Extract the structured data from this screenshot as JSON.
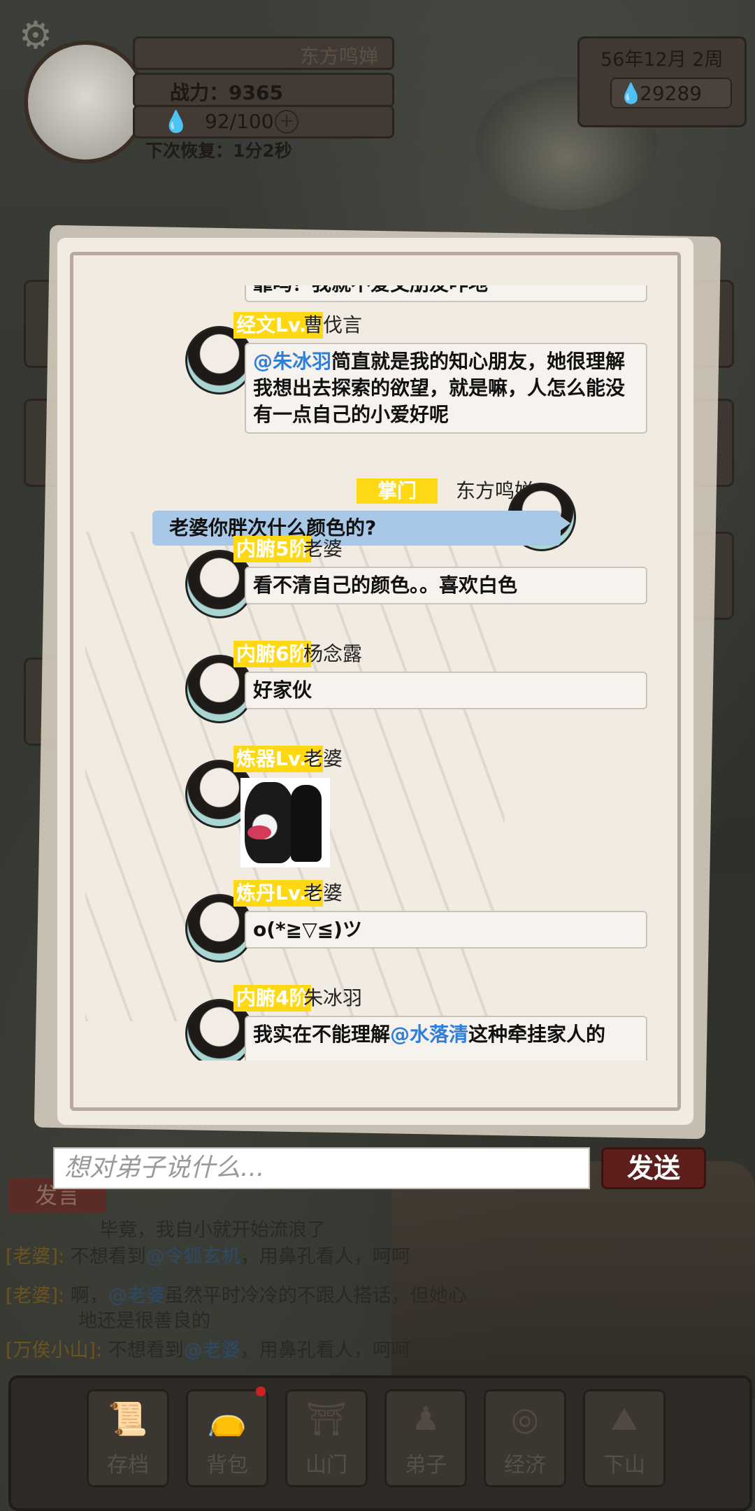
{
  "hud": {
    "player_name": "东方鸣婵",
    "power_label": "战力：9365",
    "stamina": "92/100",
    "recover_label": "下次恢复：1分2秒",
    "date": "56年12月  2周",
    "money": "29289",
    "icons": {
      "settings": "gear-icon",
      "stamina": "water-drop-icon",
      "money": "water-drop-icon",
      "add": "plus-icon"
    }
  },
  "chat": {
    "top_clipped_text": "靠吗？我就不爱交朋友咋地",
    "messages": [
      {
        "badge": "经文Lv.6",
        "name": "曹伐言",
        "mention": "@朱冰羽",
        "text": "简直就是我的知心朋友，她很理解我想出去探索的欲望，就是嘛，人怎么能没有一点自己的小爱好呢"
      },
      {
        "self": true,
        "badge": "掌门",
        "name": "东方鸣婵",
        "text": "老婆你胖次什么颜色的?"
      },
      {
        "badge": "内腑5阶",
        "name": "老婆",
        "text": "看不清自己的颜色。。喜欢白色"
      },
      {
        "badge": "内腑6阶",
        "name": "杨念露",
        "text": "好家伙"
      },
      {
        "badge": "炼器Lv.9",
        "name": "老婆",
        "sticker": "panda-meme-sticker"
      },
      {
        "badge": "炼丹Lv.6",
        "name": "老婆",
        "text": "o(*≧▽≦)ツ"
      },
      {
        "badge": "内腑4阶",
        "name": "朱冰羽",
        "prefix": "我实在不能理解",
        "mention": "@水落清",
        "suffix": "这种牵挂家人的"
      }
    ]
  },
  "input": {
    "placeholder": "想对弟子说什么...",
    "send_label": "发送"
  },
  "bg_log": {
    "speak_tab": "发言",
    "lines": [
      {
        "who": "",
        "text": "毕竟，我自小就开始流浪了"
      },
      {
        "who": "[老婆]:",
        "pre": "不想看到",
        "mention": "@令狐玄机",
        "post": "，用鼻孔看人，呵呵"
      },
      {
        "who": "[老婆]:",
        "pre": "啊，",
        "mention": "@老婆",
        "post": "虽然平时冷冷的不跟人搭话，但她心"
      },
      {
        "who": "",
        "text": "地还是很善良的"
      },
      {
        "who": "[万俟小山]:",
        "pre": "不想看到",
        "mention": "@老婆",
        "post": "，用鼻孔看人，呵呵"
      }
    ]
  },
  "nav": [
    {
      "label": "存档",
      "icon": "scroll-icon"
    },
    {
      "label": "背包",
      "icon": "bag-icon"
    },
    {
      "label": "山门",
      "icon": "gate-icon"
    },
    {
      "label": "弟子",
      "icon": "disciple-icon"
    },
    {
      "label": "经济",
      "icon": "coins-icon"
    },
    {
      "label": "下山",
      "icon": "mountain-icon"
    }
  ],
  "colors": {
    "badge": "#ffd814",
    "mention": "#2f7fd8",
    "self_bubble": "#a8c8e8",
    "send": "#5c1f1b"
  }
}
